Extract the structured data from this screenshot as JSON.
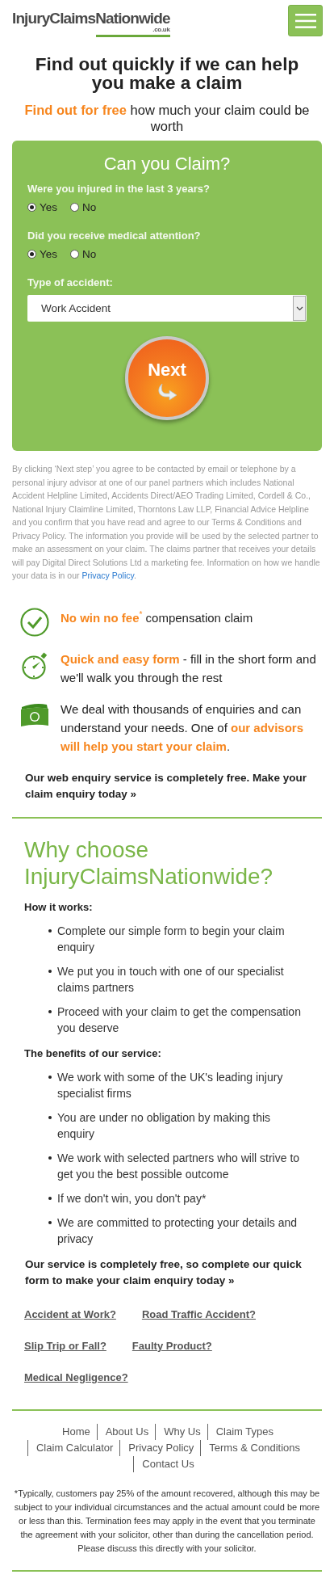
{
  "header": {
    "logo": {
      "name": "InjuryClaimsNationwide",
      "domain": ".co.uk"
    }
  },
  "headline": "Find out quickly if we can help you make a claim",
  "subheadline": {
    "highlight": "Find out for free",
    "text": "how much your claim could be worth"
  },
  "form": {
    "title": "Can you Claim?",
    "questions": [
      {
        "label": "Were you injured in the last 3 years?",
        "options": [
          {
            "label": "Yes",
            "selected": true
          },
          {
            "label": "No",
            "selected": false
          }
        ]
      },
      {
        "label": "Did you receive medical attention?",
        "options": [
          {
            "label": "Yes",
            "selected": true
          },
          {
            "label": "No",
            "selected": false
          }
        ]
      }
    ],
    "accident_type": {
      "label": "Type of accident:",
      "value": "Work Accident"
    },
    "submit": "Next"
  },
  "disclaimer": {
    "text": "By clicking ‘Next step’ you agree to be contacted by email or telephone by a personal injury advisor at one of our panel partners which includes National Accident Helpline Limited, Accidents Direct/AEO Trading Limited, Cordell & Co., National Injury Claimline Limited, Thorntons Law LLP, Financial Advice Helpline and you confirm that you have read and agree to our Terms & Conditions and Privacy Policy. The information you provide will be used by the selected partner to make an assessment on your claim. The claims partner that receives your details will pay Digital Direct Solutions Ltd a marketing fee. Information on how we handle your data is in our",
    "link": "Privacy Policy",
    "end": "."
  },
  "features": [
    {
      "kind": "check",
      "text": "**No win no fee**$^{*}$ compensation claim"
    },
    {
      "kind": "stopwatch",
      "text": "**Quick and easy form** - fill in the short form and we'll walk you through the rest"
    },
    {
      "kind": "money",
      "text": "We deal with thousands of enquiries and can understand your needs. One of **our advisors will help you start your claim**."
    }
  ],
  "cta": "Our web enquiry service is completely free. Make your claim enquiry today »",
  "why": {
    "title": "Why choose InjuryClaimsNationwide?",
    "sections": [
      {
        "heading": "How it works:",
        "items": [
          "Complete our simple form to begin your claim enquiry",
          "We put you in touch with one of our specialist claims partners",
          "Proceed with your claim to get the compensation you deserve"
        ]
      },
      {
        "heading": "The benefits of our service:",
        "items": [
          "We work with some of the UK's leading injury specialist firms",
          "You are under no obligation by making this enquiry",
          "We work with selected partners who will strive to get you the best possible outcome",
          "If we don't win, you don't pay*",
          "We are committed to protecting your details and privacy"
        ]
      }
    ],
    "cta": "Our service is completely free, so complete our quick form to make your claim enquiry today »"
  },
  "claim_links": [
    "Accident at Work?",
    "Road Traffic Accident?",
    "Slip Trip or Fall?",
    "Faulty Product?",
    "Medical Negligence?"
  ],
  "footer": {
    "nav": [
      "Home",
      "About Us",
      "Why Us",
      "Claim Types",
      "Claim Calculator",
      "Privacy Policy",
      "Terms & Conditions",
      "Contact Us"
    ],
    "note": "*Typically, customers pay 25% of the amount recovered, although this may be subject to your individual circumstances and the actual amount could be more or less than this. Termination fees may apply in the event that you terminate the agreement with your solicitor, other than during the cancellation period. Please discuss this directly with your solicitor."
  }
}
